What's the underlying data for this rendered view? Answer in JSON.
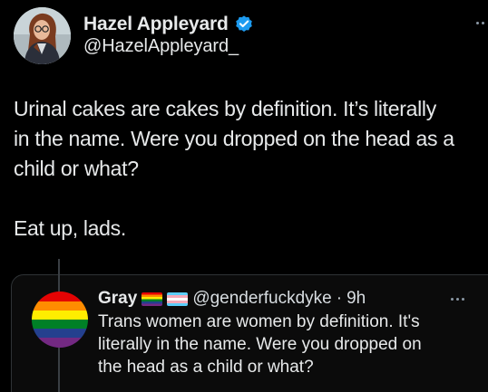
{
  "author": {
    "display_name": "Hazel Appleyard",
    "handle": "@HazelAppleyard_",
    "verified": true,
    "avatar_icon": "profile-photo-icon"
  },
  "tweet": {
    "lines": [
      "Urinal cakes are cakes by definition. It’s literally",
      "in the name. Were you dropped on the head as a",
      "child or what?"
    ],
    "line_last": "Eat up, lads."
  },
  "quoted": {
    "display_name": "Gray",
    "flags": [
      "rainbow-flag-icon",
      "trans-flag-icon"
    ],
    "handle": "@genderfuckdyke",
    "separator": "·",
    "time": "9h",
    "lines": [
      "Trans women are women by definition. It's",
      "literally in the name. Were you dropped on",
      "the head as a child or what?"
    ]
  },
  "colors": {
    "background": "#000000",
    "text": "#e7e9ea",
    "verified_blue": "#1d9bf0",
    "muted": "#8b98a5"
  }
}
